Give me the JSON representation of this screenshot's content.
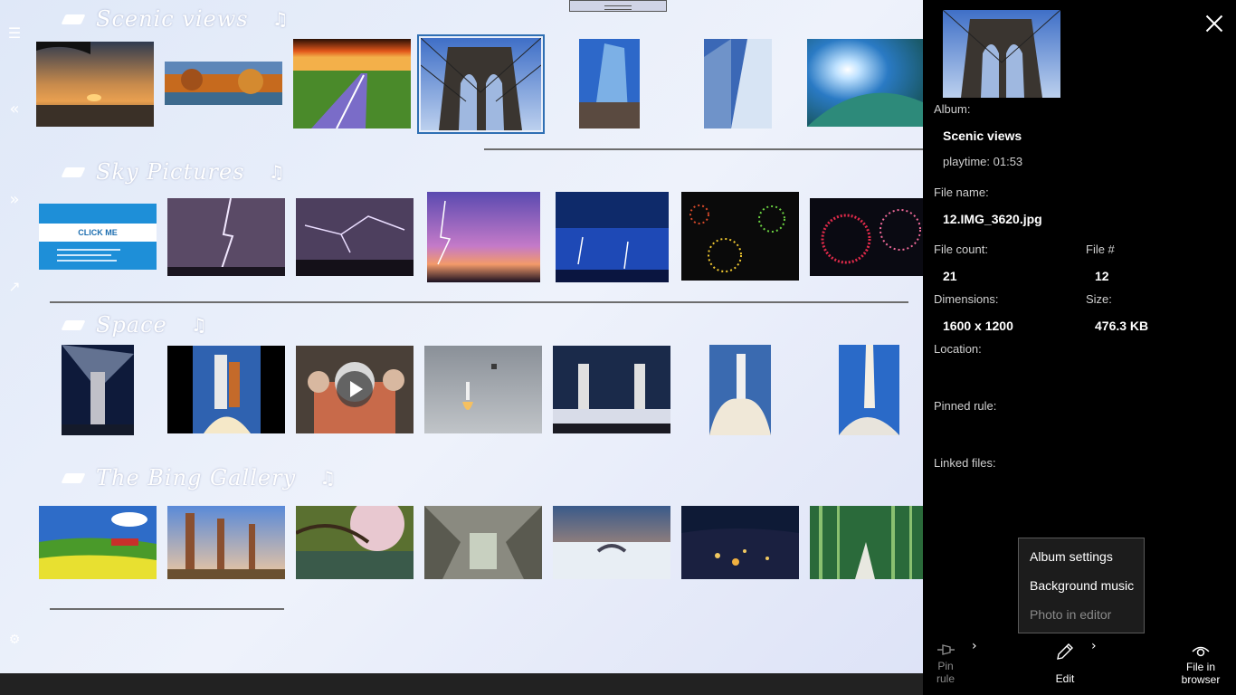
{
  "rail": {
    "menu_icon": "☰",
    "collapse_icon": "«",
    "expand_icon": "»",
    "arrow_icon": "↗",
    "settings_icon": "⚙"
  },
  "albums": [
    {
      "title": "Scenic views",
      "music_icon": "♫"
    },
    {
      "title": "Sky Pictures",
      "music_icon": "♫"
    },
    {
      "title": "Space",
      "music_icon": "♫"
    },
    {
      "title": "The Bing Gallery",
      "music_icon": "♫"
    }
  ],
  "sky_thumb_text": {
    "click_me": "CLICK ME"
  },
  "details": {
    "album_label": "Album:",
    "album_value": "Scenic views",
    "playtime": "playtime: 01:53",
    "file_name_label": "File name:",
    "file_name_value": "12.IMG_3620.jpg",
    "file_count_label": "File count:",
    "file_count_value": "21",
    "file_num_label": "File #",
    "file_num_value": "12",
    "dimensions_label": "Dimensions:",
    "dimensions_value": "1600 x 1200",
    "size_label": "Size:",
    "size_value": "476.3 KB",
    "location_label": "Location:",
    "pinned_rule_label": "Pinned rule:",
    "linked_files_label": "Linked files:"
  },
  "context_menu": {
    "album_settings": "Album settings",
    "background_music": "Background music",
    "photo_in_editor": "Photo in editor"
  },
  "commands": {
    "pin_rule_line1": "Pin",
    "pin_rule_line2": "rule",
    "edit": "Edit",
    "file_in_browser_line1": "File in",
    "file_in_browser_line2": "browser",
    "chevron": "›"
  },
  "colors": {
    "panel_bg": "#000000",
    "selection": "#2f6fb3",
    "rule": "#6d6d6d"
  }
}
